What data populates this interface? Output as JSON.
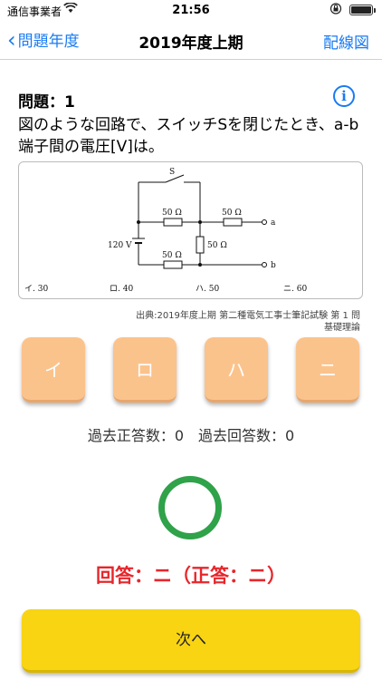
{
  "status_bar": {
    "carrier": "通信事業者",
    "time": "21:56"
  },
  "nav": {
    "back_label": "問題年度",
    "title": "2019年度上期",
    "right_label": "配線図"
  },
  "question": {
    "number_label": "問題：1",
    "text": "図のような回路で、スイッチSを閉じたとき、a-b端子間の電圧[V]は。",
    "figure": {
      "switch_label": "S",
      "resistor_top": "50 Ω",
      "resistor_right": "50 Ω",
      "resistor_middle": "50 Ω",
      "resistor_bottom": "50 Ω",
      "source_label": "120 V",
      "terminal_a": "a",
      "terminal_b": "b",
      "choices": [
        "イ. 30",
        "ロ. 40",
        "ハ. 50",
        "ニ. 60"
      ]
    },
    "source": "出典:2019年度上期 第二種電気工事士筆記試験 第 1 問",
    "category": "基礎理論"
  },
  "answers": [
    "イ",
    "ロ",
    "ハ",
    "ニ"
  ],
  "stats": "過去正答数：0　過去回答数：0",
  "result": "回答：ニ（正答：ニ）",
  "next_label": "次へ",
  "colors": {
    "accent": "#1a7bf2",
    "answer_button": "#fbc38c",
    "correct": "#2fa24a",
    "result_text": "#e7262b",
    "next_button": "#f8d413"
  }
}
